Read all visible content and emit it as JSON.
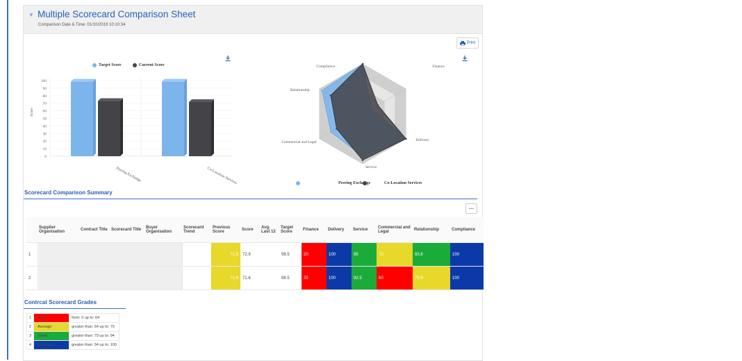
{
  "header": {
    "title": "Multiple Scorecard Comparison Sheet",
    "subtitle": "Comparison Date & Time: 01/10/2019 10:10:34"
  },
  "toolbar": {
    "print_label": "Print"
  },
  "bar_chart": {
    "legend": {
      "target": "Target Score",
      "current": "Current Score"
    },
    "ylabel": "Score",
    "yticks": [
      "100",
      "90",
      "80",
      "70",
      "60",
      "50",
      "40",
      "30",
      "20",
      "10",
      "0"
    ],
    "categories": [
      "Peering Exchange",
      "Co-Location Services"
    ]
  },
  "radar_chart": {
    "axes": [
      "Compliance",
      "Finance",
      "Delivery",
      "Service",
      "Commercial and Legal",
      "Relationship"
    ],
    "legend": {
      "a": "Peering Exchange",
      "b": "Co-Location Services"
    }
  },
  "chart_data": [
    {
      "type": "bar",
      "categories": [
        "Peering Exchange",
        "Co-Location Services"
      ],
      "series": [
        {
          "name": "Target Score",
          "values": [
            98.5,
            98.5
          ]
        },
        {
          "name": "Current Score",
          "values": [
            72.9,
            71.6
          ]
        }
      ],
      "ylabel": "Score",
      "ylim": [
        0,
        100
      ],
      "colors": [
        "#7cb5ec",
        "#434348"
      ],
      "legend_position": "top"
    },
    {
      "type": "radar",
      "axes": [
        "Compliance",
        "Finance",
        "Delivery",
        "Service",
        "Commercial and Legal",
        "Relationship"
      ],
      "series": [
        {
          "name": "Peering Exchange",
          "values": [
            100,
            20,
            100,
            85,
            73,
            93.8
          ]
        },
        {
          "name": "Co-Location Services",
          "values": [
            100,
            35,
            100,
            92.5,
            60,
            73.8
          ]
        }
      ],
      "rmax": 100,
      "colors": [
        "#7cb5ec",
        "#434348"
      ],
      "legend_position": "bottom"
    }
  ],
  "summary": {
    "title": "Scorecard Comparison Summary",
    "more_label": "...",
    "columns": [
      "Supplier Organisation",
      "Contract Title",
      "Scorecard Title",
      "Buyer Organisation",
      "Scorecard Trend",
      "Previous Score",
      "Score",
      "Avg. Last 12",
      "Target Score",
      "Finance",
      "Delivery",
      "Service",
      "Commercial and Legal",
      "Relationship",
      "Compliance"
    ],
    "rows": [
      {
        "num": "1",
        "previous": "72.9",
        "score": "72.9",
        "avg": "",
        "target": "98.5",
        "finance": "20",
        "delivery": "100",
        "service": "85",
        "commercial": "73",
        "relationship": "93.8",
        "compliance": "100"
      },
      {
        "num": "2",
        "previous": "71.6",
        "score": "71.6",
        "avg": "",
        "target": "98.5",
        "finance": "35",
        "delivery": "100",
        "service": "92.5",
        "commercial": "60",
        "relationship": "73.8",
        "compliance": "100"
      }
    ]
  },
  "grades": {
    "title": "Contrcat Scorecard Grades",
    "items": [
      {
        "num": "1",
        "name": "Poor",
        "range": "from: 0 up to: 64",
        "color": "#ff0000"
      },
      {
        "num": "2",
        "name": "Average",
        "range": "greater than: 64 up to: 79",
        "color": "#e8d82a"
      },
      {
        "num": "3",
        "name": "Good",
        "range": "greater than: 79 up to: 94",
        "color": "#1aab3a"
      },
      {
        "num": "4",
        "name": "Excellent",
        "range": "greater than: 94 up to: 100",
        "color": "#0b3aa8"
      }
    ]
  },
  "colors": {
    "poor": "#ff0000",
    "average": "#e8d82a",
    "good": "#1aab3a",
    "excellent": "#0b3aa8",
    "accent": "#2563b8"
  }
}
